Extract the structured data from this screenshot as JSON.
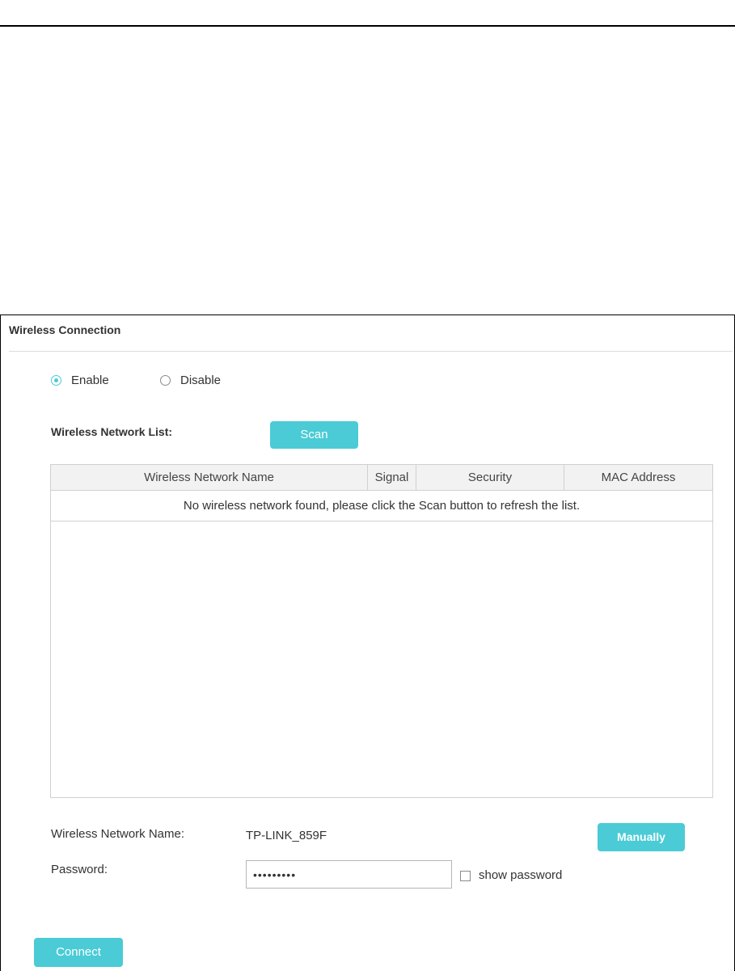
{
  "panel": {
    "title": "Wireless Connection"
  },
  "mode": {
    "enable_label": "Enable",
    "disable_label": "Disable",
    "selected": "Enable"
  },
  "network_list": {
    "label": "Wireless Network List:",
    "scan_label": "Scan",
    "columns": [
      "Wireless Network Name",
      "Signal",
      "Security",
      "MAC Address"
    ],
    "empty_message": "No wireless network found, please click the Scan button to refresh the list."
  },
  "form": {
    "ssid_label": "Wireless Network Name:",
    "ssid_value": "TP-LINK_859F",
    "manually_label": "Manually",
    "password_label": "Password:",
    "password_value": "•••••••••",
    "show_password_label": "show password",
    "show_password_checked": false
  },
  "actions": {
    "connect_label": "Connect"
  },
  "colors": {
    "accent": "#4acbd6",
    "table_header_bg": "#f2f2f2"
  }
}
